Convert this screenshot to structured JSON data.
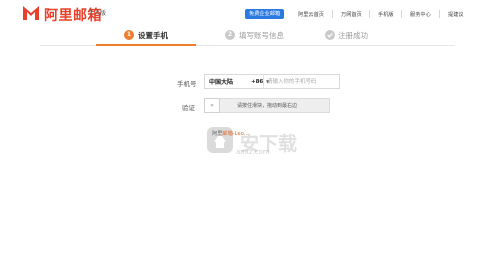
{
  "header": {
    "brand": "阿里邮箱",
    "edition": "个人版",
    "promo": "免费企业邮箱",
    "links": [
      "阿里云首页",
      "万网首页",
      "手机版",
      "服务中心",
      "提建议"
    ]
  },
  "steps": [
    {
      "number": "1",
      "label": "设置手机",
      "state": "active"
    },
    {
      "number": "2",
      "label": "填写账号信息",
      "state": "pending"
    },
    {
      "number": "",
      "label": "注册成功",
      "state": "pending"
    }
  ],
  "form": {
    "phone_label": "手机号",
    "country": "中国大陆",
    "country_code": "+86",
    "phone_placeholder": "请输入你的手机号码",
    "phone_value": "",
    "verify_label": "验证",
    "slider_handle": "»",
    "slider_text": "请按住滑块，拖动到最右边",
    "hint_prefix": "阿里",
    "hint_link": "邮箱-Leo..."
  },
  "watermark": {
    "text": "安下载",
    "sub": "anxz.com"
  },
  "colors": {
    "accent": "#f07c2f",
    "brand": "#e8402a",
    "promo": "#2a7ae2"
  }
}
